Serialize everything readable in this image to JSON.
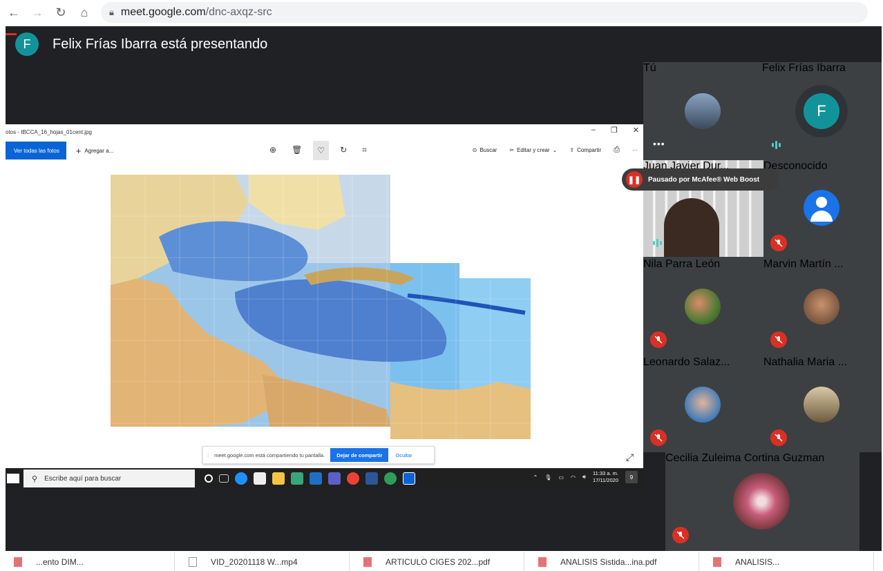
{
  "browser": {
    "url_host": "meet.google.com",
    "url_path": "/dnc-axqz-src"
  },
  "meet": {
    "presenter_initial": "F",
    "presenter_text": "Felix Frías Ibarra está presentando"
  },
  "shared_window": {
    "title": "otos - IBCCA_16_hojas_01cent.jpg",
    "see_all_label": "Ver todas las fotos",
    "add_label": "Agregar a...",
    "search_label": "Buscar",
    "edit_label": "Editar y crear",
    "share_label": "Compartir",
    "share_notice": "meet.google.com está compartiendo tu pantalla.",
    "stop_share_label": "Dejar de compartir",
    "hide_label": "Ocultar",
    "taskbar_search_placeholder": "Escribe aquí para buscar",
    "clock_time": "11:33 a. m.",
    "clock_date": "17/11/2020",
    "notification_count": "9"
  },
  "mcafee_notice": "Pausado por McAfee® Web Boost",
  "participants": [
    {
      "name": "Tú",
      "status": "dots"
    },
    {
      "name": "Felix Frías Ibarra",
      "initial": "F",
      "status": "speaking"
    },
    {
      "name": "Juan Javier Dur...",
      "status": "speaking"
    },
    {
      "name": "Desconocido",
      "status": "muted"
    },
    {
      "name": "Nila Parra León",
      "status": "muted"
    },
    {
      "name": "Marvin Martín ...",
      "status": "muted"
    },
    {
      "name": "Leonardo Salaz...",
      "status": "muted"
    },
    {
      "name": "Nathalia Maria ...",
      "status": "muted"
    },
    {
      "name": "Cecilia Zuleima Cortina Guzman",
      "status": "muted"
    }
  ],
  "downloads": [
    {
      "name": "...ento DIM..."
    },
    {
      "name": "VID_20201118 W...mp4"
    },
    {
      "name": "ARTICULO CIGES 202...pdf"
    },
    {
      "name": "ANALISIS Sistida...ina.pdf"
    },
    {
      "name": "ANALISIS..."
    }
  ],
  "colors": {
    "meet_bg": "#202124",
    "tile_bg": "#3c4043",
    "muted_red": "#d93025",
    "presenter_teal": "#12939a",
    "share_blue": "#1a73e8"
  }
}
